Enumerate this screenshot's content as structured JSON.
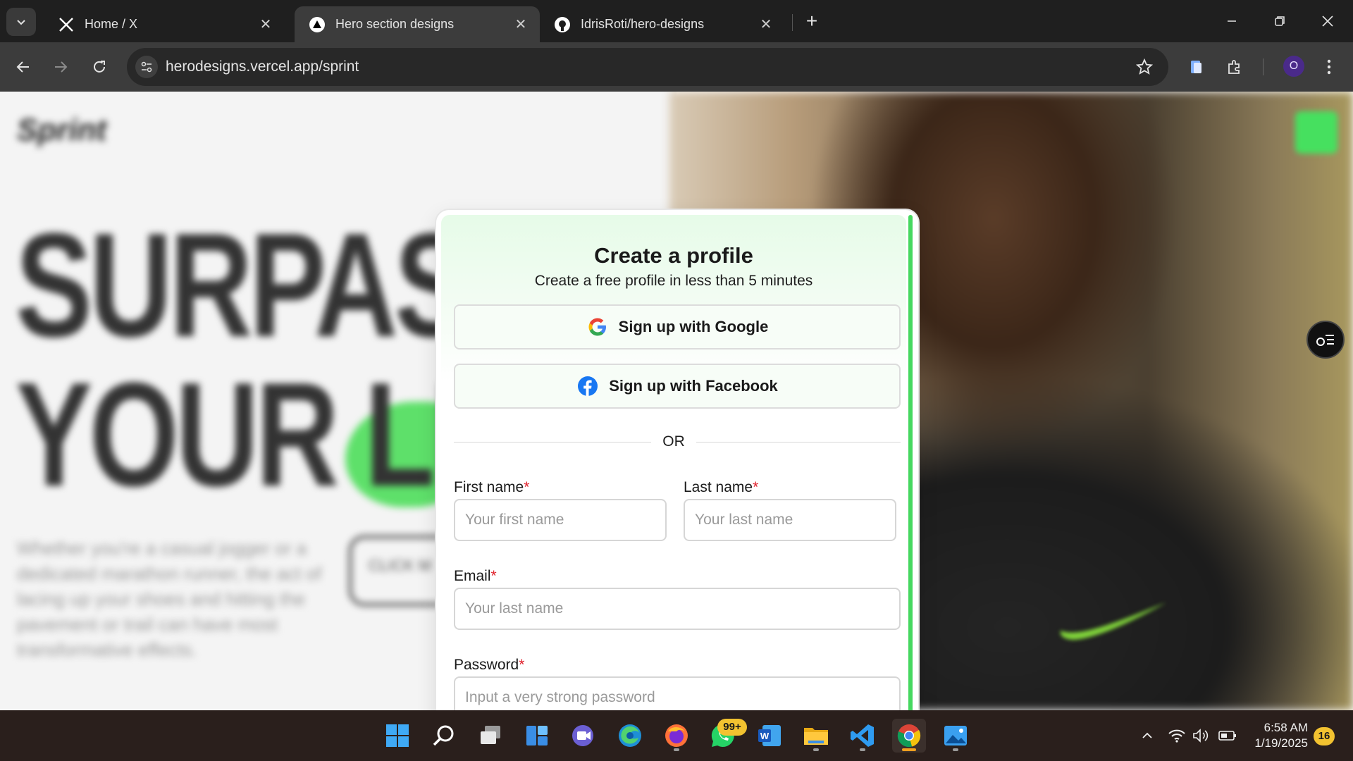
{
  "browser": {
    "tabs": [
      {
        "title": "Home / X",
        "icon": "x-logo-icon"
      },
      {
        "title": "Hero section designs",
        "icon": "vercel-logo-icon",
        "active": true
      },
      {
        "title": "IdrisRoti/hero-designs",
        "icon": "github-logo-icon"
      }
    ],
    "url": "herodesigns.vercel.app/sprint",
    "profile_initial": "O"
  },
  "page": {
    "brand": "Sprint",
    "headline_line1": "SURPAS",
    "headline_line2": "YOUR LI",
    "paragraph": "Whether you're a casual jogger or a dedicated marathon runner, the act of lacing up your shoes and hitting the pavement or trail can have most transformative effects.",
    "cta": "CLICK M"
  },
  "modal": {
    "title": "Create a profile",
    "subtitle": "Create a free profile in less than 5 minutes",
    "google_button": "Sign up with Google",
    "facebook_button": "Sign up with Facebook",
    "or_text": "OR",
    "fields": {
      "first_name": {
        "label": "First name",
        "required_mark": "*",
        "placeholder": "Your first name",
        "value": ""
      },
      "last_name": {
        "label": "Last name",
        "required_mark": "*",
        "placeholder": "Your last name",
        "value": ""
      },
      "email": {
        "label": "Email",
        "required_mark": "*",
        "placeholder": "Your last name",
        "value": ""
      },
      "password": {
        "label": "Password",
        "required_mark": "*",
        "placeholder": "Input a very strong password",
        "value": ""
      }
    },
    "accent_color": "#46d860"
  },
  "taskbar": {
    "whatsapp_badge": "99+",
    "time": "6:58 AM",
    "date": "1/19/2025",
    "notification_count": "16"
  }
}
